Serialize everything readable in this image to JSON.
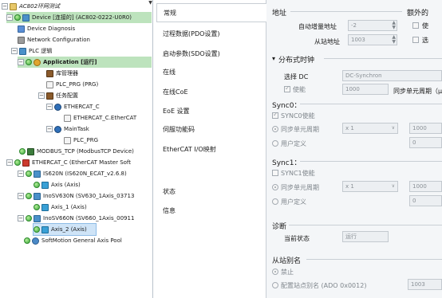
{
  "tree": {
    "items": [
      {
        "label": "AC802环网测试",
        "indent": 0
      },
      {
        "label": "Device [连接的] (AC802-0222-U0R0)",
        "indent": 1
      },
      {
        "label": "Device Diagnosis",
        "indent": 2
      },
      {
        "label": "Network Configuration",
        "indent": 2
      },
      {
        "label": "PLC 逻辑",
        "indent": 2
      },
      {
        "label": "Application [运行]",
        "indent": 3
      },
      {
        "label": "库管理器",
        "indent": 4
      },
      {
        "label": "PLC_PRG (PRG)",
        "indent": 4
      },
      {
        "label": "任务配置",
        "indent": 4
      },
      {
        "label": "ETHERCAT_C",
        "indent": 5
      },
      {
        "label": "ETHERCAT_C.EtherCAT",
        "indent": 6
      },
      {
        "label": "MainTask",
        "indent": 5
      },
      {
        "label": "PLC_PRG",
        "indent": 6
      },
      {
        "label": "MODBUS_TCP (ModbusTCP Device)",
        "indent": 2
      },
      {
        "label": "ETHERCAT_C (EtherCAT Master Soft",
        "indent": 2
      },
      {
        "label": "IS620N (IS620N_ECAT_v2.6.8)",
        "indent": 3
      },
      {
        "label": "Axis (Axis)",
        "indent": 4
      },
      {
        "label": "InoSV630N (SV630_1Axis_03713",
        "indent": 3
      },
      {
        "label": "Axis_1 (Axis)",
        "indent": 4
      },
      {
        "label": "InoSV660N (SV660_1Axis_00911",
        "indent": 3
      },
      {
        "label": "Axis_2 (Axis)",
        "indent": 4
      },
      {
        "label": "SoftMotion General Axis Pool",
        "indent": 2
      }
    ],
    "scroll_icon": "scroll-down-icon"
  },
  "tabs": [
    {
      "label": "常规"
    },
    {
      "label": "过程数据(PDO设置)"
    },
    {
      "label": "启动参数(SDO设置)"
    },
    {
      "label": "在线"
    },
    {
      "label": "在线CoE"
    },
    {
      "label": "EoE 设置"
    },
    {
      "label": "伺服功能码"
    },
    {
      "label": "EtherCAT I/O映射"
    },
    {
      "label": "状态"
    },
    {
      "label": "信息"
    }
  ],
  "address": {
    "title": "地址",
    "extra_title": "额外的",
    "auto_inc_label": "自动增量地址",
    "auto_inc_value": "-2",
    "slave_label": "从站地址",
    "slave_value": "1003",
    "check1": "使",
    "check2": "选"
  },
  "dc": {
    "title": "分布式时钟",
    "select_label": "选择 DC",
    "select_value": "DC-Synchron",
    "enable_label": "使能",
    "cycle_value": "1000",
    "cycle_label": "同步单元周期（μs"
  },
  "sync0": {
    "title": "Sync0：",
    "enable_label": "SYNC0使能",
    "unit_cycle_label": "同步单元周期",
    "multiplier": "x 1",
    "cycle_value": "1000",
    "user_def_label": "用户定义",
    "user_value": "0"
  },
  "sync1": {
    "title": "Sync1：",
    "enable_label": "SYNC1使能",
    "unit_cycle_label": "同步单元周期",
    "multiplier": "x 1",
    "cycle_value": "1000",
    "user_def_label": "用户定义",
    "user_value": "0"
  },
  "diag": {
    "title": "诊断",
    "state_label": "当前状态",
    "state_value": "运行"
  },
  "alias": {
    "title": "从站别名",
    "disable_label": "禁止",
    "config_label": "配置站点别名 (ADO 0x0012)",
    "config_value": "1003"
  }
}
